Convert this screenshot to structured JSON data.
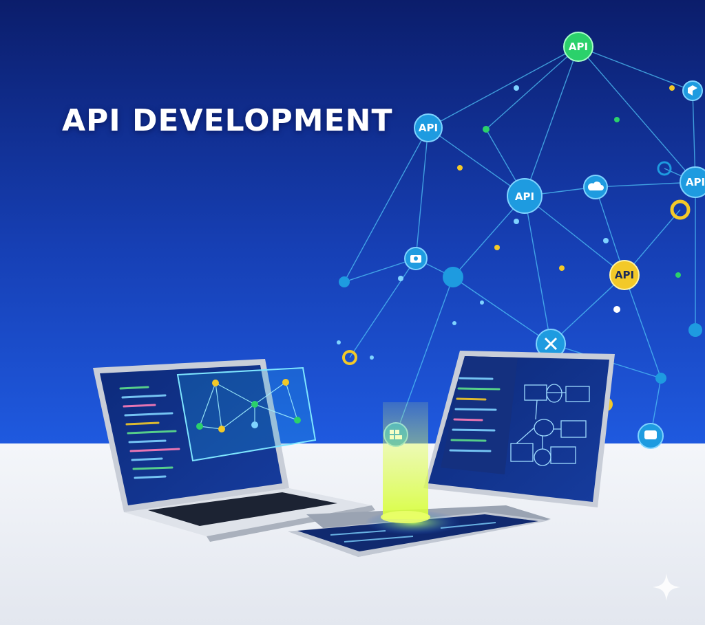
{
  "title": "API DEVELOPMENT",
  "colors": {
    "background_top": "#0b1d6b",
    "background_bottom": "#1f56d8",
    "floor": "#eef1f6",
    "node_blue": "#1e9be0",
    "node_green": "#2bd16b",
    "node_yellow": "#f3c928",
    "line": "#4fc3f7"
  },
  "network": {
    "api_nodes": [
      {
        "label": "API",
        "color": "green"
      },
      {
        "label": "API",
        "color": "blue"
      },
      {
        "label": "API",
        "color": "blue"
      },
      {
        "label": "API",
        "color": "yellow"
      },
      {
        "label": "API",
        "color": "blue"
      }
    ],
    "icon_nodes": [
      "cloud-icon",
      "camera-icon",
      "gear-icon",
      "box-icon",
      "chat-icon",
      "grid-icon"
    ]
  },
  "devices": [
    "laptop",
    "tablet",
    "monitor"
  ]
}
